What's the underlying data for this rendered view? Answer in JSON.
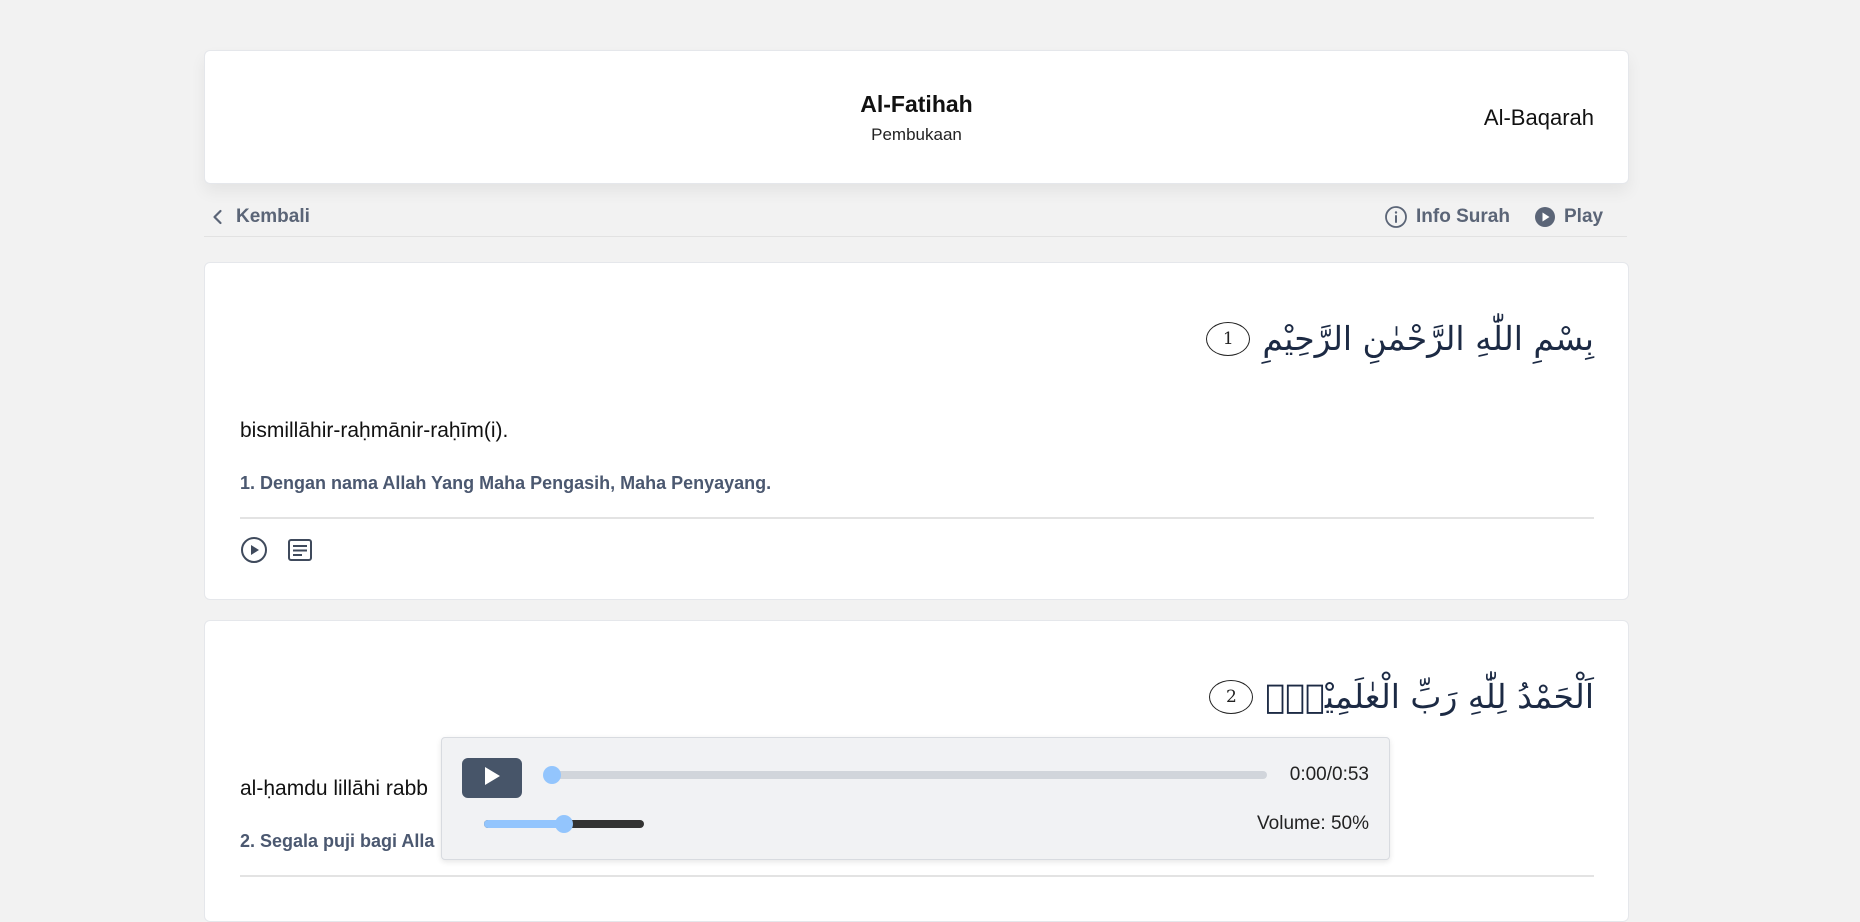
{
  "header": {
    "surah_title": "Al-Fatihah",
    "surah_subtitle": "Pembukaan",
    "next_surah": "Al-Baqarah"
  },
  "toolbar": {
    "back_label": "Kembali",
    "info_label": "Info Surah",
    "play_label": "Play"
  },
  "ayahs": [
    {
      "number": "1",
      "arabic": "بِسْمِ اللّٰهِ الرَّحْمٰنِ الرَّحِيْمِ",
      "latin": "bismillāhir-raḥmānir-raḥīm(i).",
      "translation": "1. Dengan nama Allah Yang Maha Pengasih, Maha Penyayang."
    },
    {
      "number": "2",
      "arabic": "اَلْحَمْدُ لِلّٰهِ رَبِّ الْعٰلَمِيْنَۙ",
      "latin": "al-ḥamdu lillāhi rabb",
      "translation": "2. Segala puji bagi Alla"
    }
  ],
  "icons": {
    "back": "chevron-left-icon",
    "info": "info-circle-icon",
    "play": "play-circle-icon",
    "tafsir": "text-document-icon",
    "player_play": "play-triangle-icon"
  },
  "player": {
    "time": "0:00/0:53",
    "progress": 0,
    "volume_label": "Volume: 50%",
    "volume": 0.5
  },
  "colors": {
    "accent": "#93c5fd",
    "play_button": "#475569",
    "muted_text": "#5b6577"
  }
}
